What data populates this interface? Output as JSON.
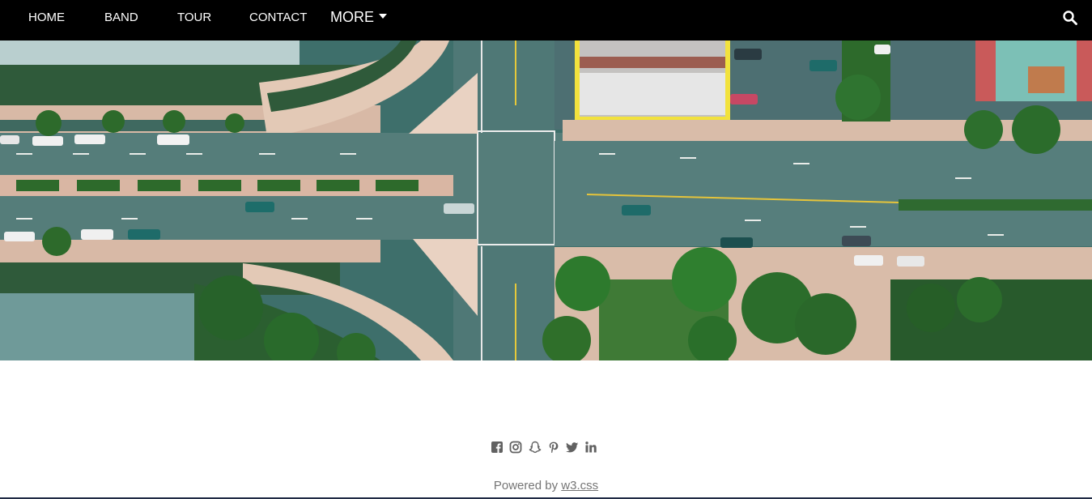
{
  "nav": {
    "items": [
      {
        "label": "HOME"
      },
      {
        "label": "BAND"
      },
      {
        "label": "TOUR"
      },
      {
        "label": "CONTACT"
      }
    ],
    "more_label": "MORE",
    "search_icon": "search-icon"
  },
  "hero": {
    "image": "aerial-city-intersection"
  },
  "footer": {
    "social_icons": [
      "facebook-icon",
      "instagram-icon",
      "snapchat-icon",
      "pinterest-icon",
      "twitter-icon",
      "linkedin-icon"
    ],
    "powered_prefix": "Powered by",
    "powered_link": "w3.css"
  },
  "colors": {
    "navbar_bg": "#000000",
    "text_gray": "#757575"
  }
}
